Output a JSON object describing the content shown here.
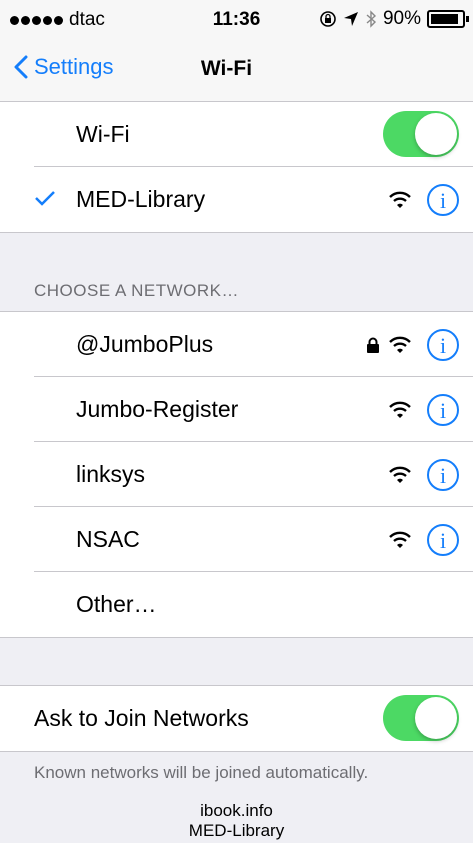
{
  "status_bar": {
    "carrier": "dtac",
    "time": "11:36",
    "battery": "90%",
    "battery_level": 0.9
  },
  "nav": {
    "back_label": "Settings",
    "title": "Wi-Fi"
  },
  "wifi_section": {
    "wifi_label": "Wi-Fi",
    "wifi_on": true,
    "connected_network": "MED-Library"
  },
  "networks": {
    "header": "CHOOSE A NETWORK…",
    "items": [
      {
        "name": "@JumboPlus",
        "secured": true
      },
      {
        "name": "Jumbo-Register",
        "secured": false
      },
      {
        "name": "linksys",
        "secured": false
      },
      {
        "name": "NSAC",
        "secured": false
      }
    ],
    "other_label": "Other…"
  },
  "ask_section": {
    "label": "Ask to Join Networks",
    "enabled": true,
    "footer": "Known networks will be joined automatically."
  },
  "bottom": {
    "line1": "ibook.info",
    "line2": "MED-Library"
  },
  "colors": {
    "accent": "#147efb",
    "toggle_on": "#4cd964",
    "background": "#efeff4"
  }
}
